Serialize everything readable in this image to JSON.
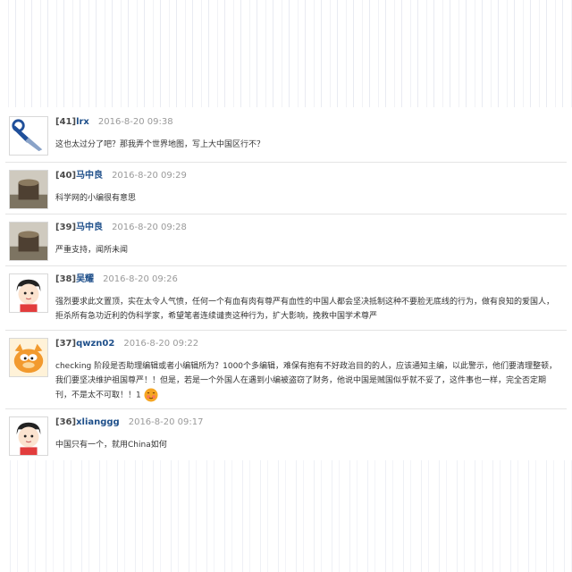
{
  "comments": [
    {
      "num": "[41]",
      "user": "lrx",
      "time": "2016-8-20 09:38",
      "text": "这也太过分了吧？那我弄个世界地图，写上大中国区行不？",
      "avatar": "wrench-icon"
    },
    {
      "num": "[40]",
      "user": "马中良",
      "time": "2016-8-20 09:29",
      "text": "科学网的小编很有意思",
      "avatar": "tree-stump-photo"
    },
    {
      "num": "[39]",
      "user": "马中良",
      "time": "2016-8-20 09:28",
      "text": "严重支持，闻所未闻",
      "avatar": "tree-stump-photo"
    },
    {
      "num": "[38]",
      "user": "吴耀",
      "time": "2016-8-20 09:26",
      "text": "强烈要求此文置顶，实在太令人气愤，任何一个有血有肉有尊严有血性的中国人都会坚决抵制这种不要脸无底线的行为，做有良知的爱国人，拒杀所有急功近利的伪科学家，希望笔者连续谴责这种行为，扩大影响，挽救中国学术尊严",
      "avatar": "cartoon-boy-icon"
    },
    {
      "num": "[37]",
      "user": "qwzn02",
      "time": "2016-8-20 09:22",
      "text": "checking 阶段是否助理编辑或者小编辑所为？1000个多编辑，难保有抱有不好政治目的的人，应该通知主编，以此警示，他们要清理整顿，我们要坚决维护祖国尊严！！但是，若是一个外国人在遇到小编被盗窃了财务，他说中国是贼国似乎就不妥了，这件事也一样，完全否定期刊，不是太不可取！！1",
      "avatar": "garfield-icon",
      "emoji": "blushing-face-icon"
    },
    {
      "num": "[36]",
      "user": "xlianggg",
      "time": "2016-8-20 09:17",
      "text": "中国只有一个，就用China如何",
      "avatar": "cartoon-boy-icon"
    }
  ]
}
